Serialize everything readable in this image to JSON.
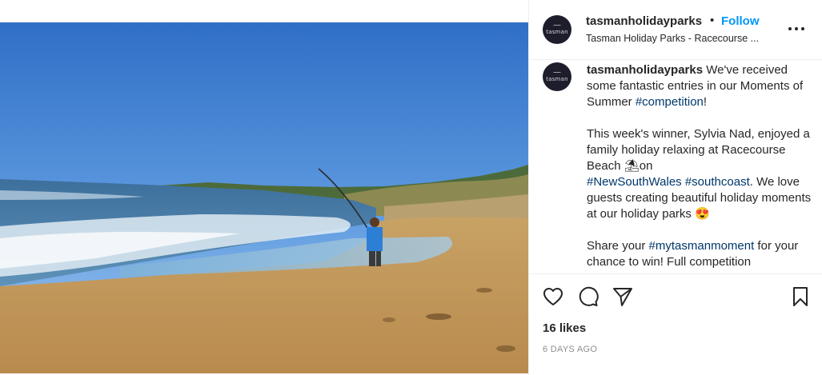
{
  "post": {
    "username": "tasmanholidayparks",
    "separator": "•",
    "follow_label": "Follow",
    "location": "Tasman Holiday Parks - Racecourse ...",
    "avatar_text": "tasman",
    "more_icon": "more-horizontal-icon"
  },
  "caption": {
    "username": "tasmanholidayparks",
    "line1_text": " We've received some fantastic entries in our Moments of Summer ",
    "line1_tag": "#competition",
    "line1_end": "!",
    "para2_text": "This week's winner, Sylvia Nad, enjoyed a family holiday relaxing at Racecourse Beach ",
    "para2_emoji": "⛱",
    "para2_on": "on ",
    "para2_tag1": "#NewSouthWales",
    "para2_tag2": "#southcoast",
    "para2_rest": ". We love guests creating beautiful holiday moments at our holiday parks ",
    "para2_emoji2": "😍",
    "para3_text": "Share your ",
    "para3_tag": "#mytasmanmoment",
    "para3_rest": " for your chance to win! Full competition"
  },
  "actions": {
    "like_icon": "heart-icon",
    "comment_icon": "comment-icon",
    "share_icon": "share-icon",
    "save_icon": "bookmark-icon"
  },
  "stats": {
    "likes": "16 likes",
    "time_ago": "6 DAYS AGO"
  },
  "colors": {
    "link": "#0095f6",
    "hashtag": "#00376b",
    "muted": "#8e8e8e"
  }
}
